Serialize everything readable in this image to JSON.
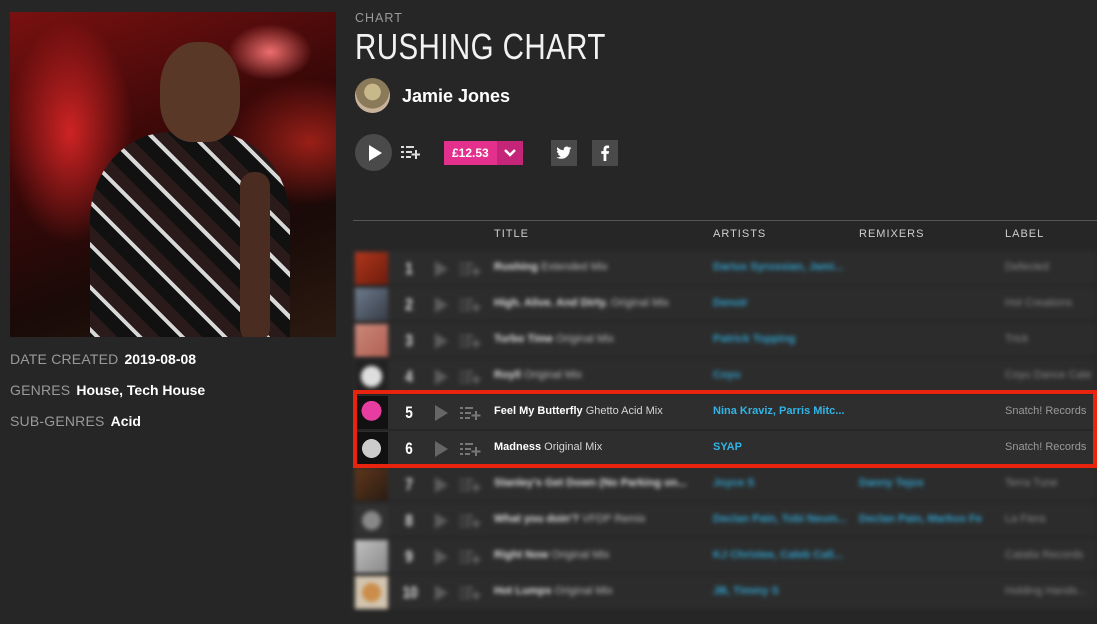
{
  "sidebar": {
    "date_created_label": "DATE CREATED",
    "date_created_value": "2019-08-08",
    "genres_label": "GENRES",
    "genres_value": "House, Tech House",
    "subgenres_label": "SUB-GENRES",
    "subgenres_value": "Acid"
  },
  "header": {
    "kicker": "CHART",
    "title": "RUSHING CHART",
    "artist": "Jamie Jones",
    "price": "£12.53"
  },
  "table": {
    "headers": {
      "title": "TITLE",
      "artists": "ARTISTS",
      "remixers": "REMIXERS",
      "label": "LABEL"
    },
    "rows": [
      {
        "num": "1",
        "title": "Rushing",
        "mix": "Extended Mix",
        "artists": "Darius Syrossian, Jami...",
        "remixers": "",
        "label": "Defected",
        "blurred": true
      },
      {
        "num": "2",
        "title": "High. Alive. And Dirty.",
        "mix": "Original Mix",
        "artists": "Denoir",
        "remixers": "",
        "label": "Hot Creations",
        "blurred": true
      },
      {
        "num": "3",
        "title": "Turbo Time",
        "mix": "Original Mix",
        "artists": "Patrick Topping",
        "remixers": "",
        "label": "Trick",
        "blurred": true
      },
      {
        "num": "4",
        "title": "Royll",
        "mix": "Original Mix",
        "artists": "Coyu",
        "remixers": "",
        "label": "Coyu Dance Cate...",
        "blurred": true
      },
      {
        "num": "5",
        "title": "Feel My Butterfly",
        "mix": "Ghetto Acid Mix",
        "artists": "Nina Kraviz, Parris Mitc...",
        "remixers": "",
        "label": "Snatch! Records",
        "blurred": false
      },
      {
        "num": "6",
        "title": "Madness",
        "mix": "Original Mix",
        "artists": "SYAP",
        "remixers": "",
        "label": "Snatch! Records",
        "blurred": false
      },
      {
        "num": "7",
        "title": "Stanley's Get Down (No Parking on...",
        "mix": "",
        "artists": "Joyce S",
        "remixers": "Danny Tejos",
        "label": "Terra Tune",
        "blurred": true
      },
      {
        "num": "8",
        "title": "What you doin'?",
        "mix": "VFDP Remix",
        "artists": "Declan Pain, Tobi Neum...",
        "remixers": "Declan Pain, Markus Fe",
        "label": "La Fiera",
        "blurred": true
      },
      {
        "num": "9",
        "title": "Right Now",
        "mix": "Original Mix",
        "artists": "KJ Christee, Caleb Call...",
        "remixers": "",
        "label": "Catalia Records",
        "blurred": true
      },
      {
        "num": "10",
        "title": "Hot Lumps",
        "mix": "Original Mix",
        "artists": "JB, Timmy S",
        "remixers": "",
        "label": "Holding Hands...",
        "blurred": true
      }
    ]
  },
  "colors": {
    "accent_price": "#e3308d",
    "link": "#32b4e6",
    "highlight": "#e8230e"
  },
  "icons": [
    "play-icon",
    "add-to-queue-icon",
    "chevron-down-icon",
    "twitter-icon",
    "facebook-icon"
  ]
}
